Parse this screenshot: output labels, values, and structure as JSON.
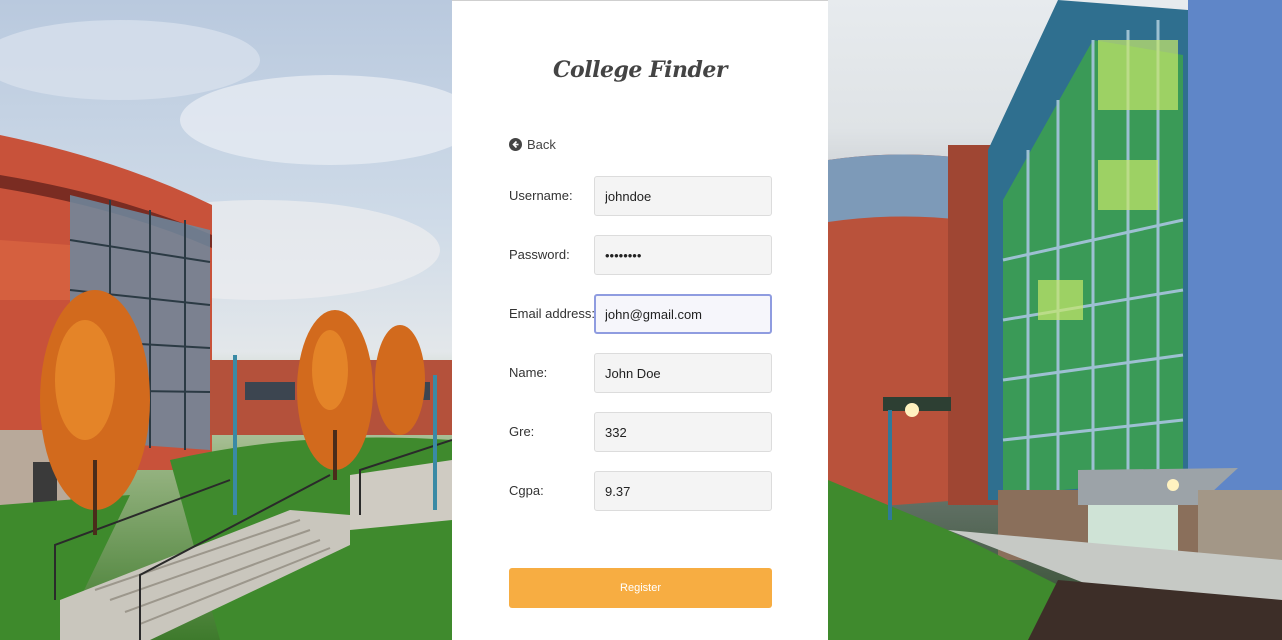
{
  "app": {
    "title": "College Finder"
  },
  "nav": {
    "back_label": "Back"
  },
  "form": {
    "fields": [
      {
        "label": "Username:",
        "value": "johndoe",
        "type": "text"
      },
      {
        "label": "Password:",
        "value": "password",
        "type": "password"
      },
      {
        "label": "Email address:",
        "value": "john@gmail.com",
        "type": "text"
      },
      {
        "label": "Name:",
        "value": "John Doe",
        "type": "text"
      },
      {
        "label": "Gre:",
        "value": "332",
        "type": "text"
      },
      {
        "label": "Cgpa:",
        "value": "9.37",
        "type": "text"
      }
    ],
    "submit_label": "Register"
  },
  "colors": {
    "accent": "#f7ad42",
    "focus_border": "#8f9ce0",
    "input_bg": "#f4f4f4"
  },
  "icons": {
    "back": "arrow-circle-left-icon"
  }
}
